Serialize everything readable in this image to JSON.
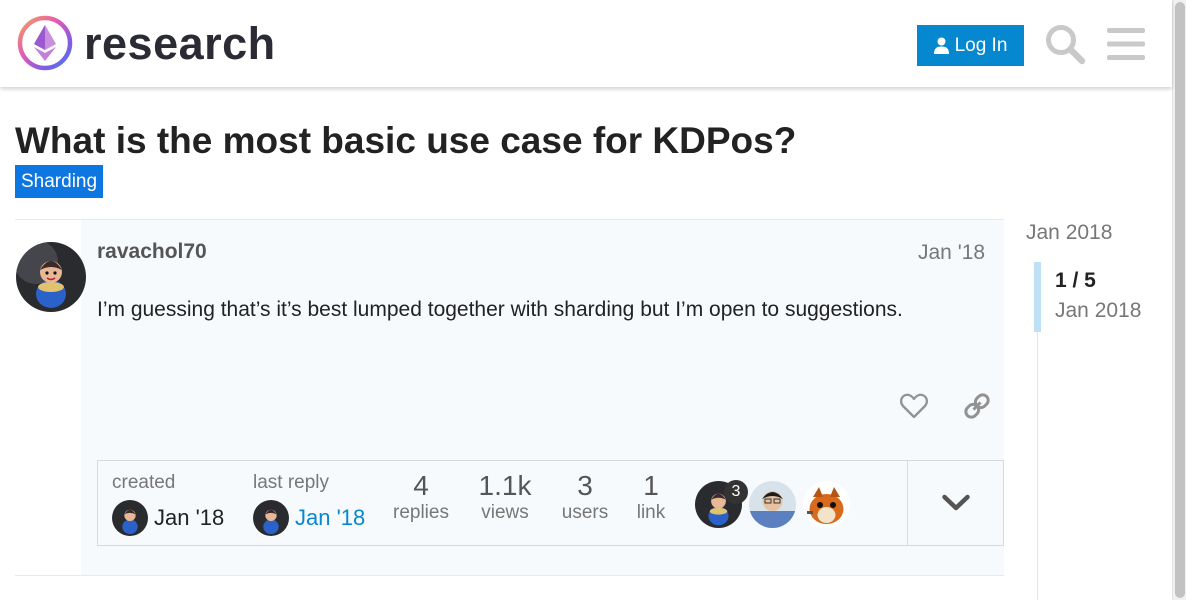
{
  "header": {
    "site_name": "research",
    "login_label": "Log In",
    "search_icon": "search-icon",
    "menu_icon": "hamburger-menu-icon",
    "accent_color": "#0688d0"
  },
  "topic": {
    "title": "What is the most basic use case for KDPos?",
    "category": "Sharding",
    "category_color": "#0e76e0"
  },
  "post": {
    "username": "ravachol70",
    "date": "Jan '18",
    "body": "I’m guessing that’s it’s best lumped together with sharding but I’m open to suggestions.",
    "actions": [
      "heart-icon",
      "link-icon"
    ]
  },
  "topic_map": {
    "created_label": "created",
    "created_date": "Jan '18",
    "last_reply_label": "last reply",
    "last_reply_date": "Jan '18",
    "stats": [
      {
        "num": "4",
        "label": "replies"
      },
      {
        "num": "1.1k",
        "label": "views"
      },
      {
        "num": "3",
        "label": "users"
      },
      {
        "num": "1",
        "label": "link"
      }
    ],
    "top_poster_count": "3",
    "expand_icon": "chevron-down-icon"
  },
  "timeline": {
    "start_date": "Jan 2018",
    "position": "1 / 5",
    "current_date": "Jan 2018"
  }
}
